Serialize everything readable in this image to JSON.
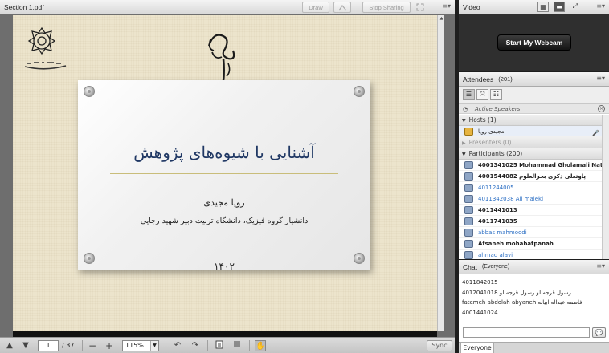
{
  "share": {
    "title": "Section 1.pdf",
    "draw_label": "Draw",
    "stop_sharing_label": "Stop Sharing",
    "page_current": "1",
    "page_total": "/ 37",
    "zoom": "115%",
    "sync_label": "Sync"
  },
  "slide": {
    "title": "آشنایی با شیوه‌های پژوهش",
    "author": "رویا مجیدی",
    "affiliation": "دانشیار گروه فیزیک، دانشگاه تربیت دبیر شهید رجایی",
    "year": "۱۴۰۲",
    "background_color": "#ece4cc",
    "title_color": "#203864"
  },
  "video": {
    "title": "Video",
    "webcam_button": "Start My Webcam"
  },
  "attendees": {
    "title": "Attendees",
    "count": "(201)",
    "active_speakers": "Active Speakers",
    "groups": {
      "hosts": "Hosts (1)",
      "presenters": "Presenters (0)",
      "participants": "Participants (200)"
    },
    "host_name": "مجیدی رویا",
    "participants": [
      "4001341025 Mohammad Gholamali Nataj",
      "4001544082 پاوتعلی ذکری بحرالعلوم",
      "4011244005",
      "4011342038 Ali maleki",
      "4011441013",
      "4011741035",
      "abbas mahmoodi",
      "Afsaneh mohabatpanah",
      "ahmad alavi"
    ]
  },
  "chat": {
    "title": "Chat",
    "scope": "(Everyone)",
    "messages": [
      "4011842015",
      "4012041018 رسول قرجه لو رسول قرجه لو",
      "fatemeh abdolah abyaneh فاطمه عبداله ابیانه",
      "4001441024"
    ],
    "tab_label": "Everyone"
  },
  "icons": {
    "menu": "menu-lines-icon",
    "send": "speech-bubble-icon"
  }
}
